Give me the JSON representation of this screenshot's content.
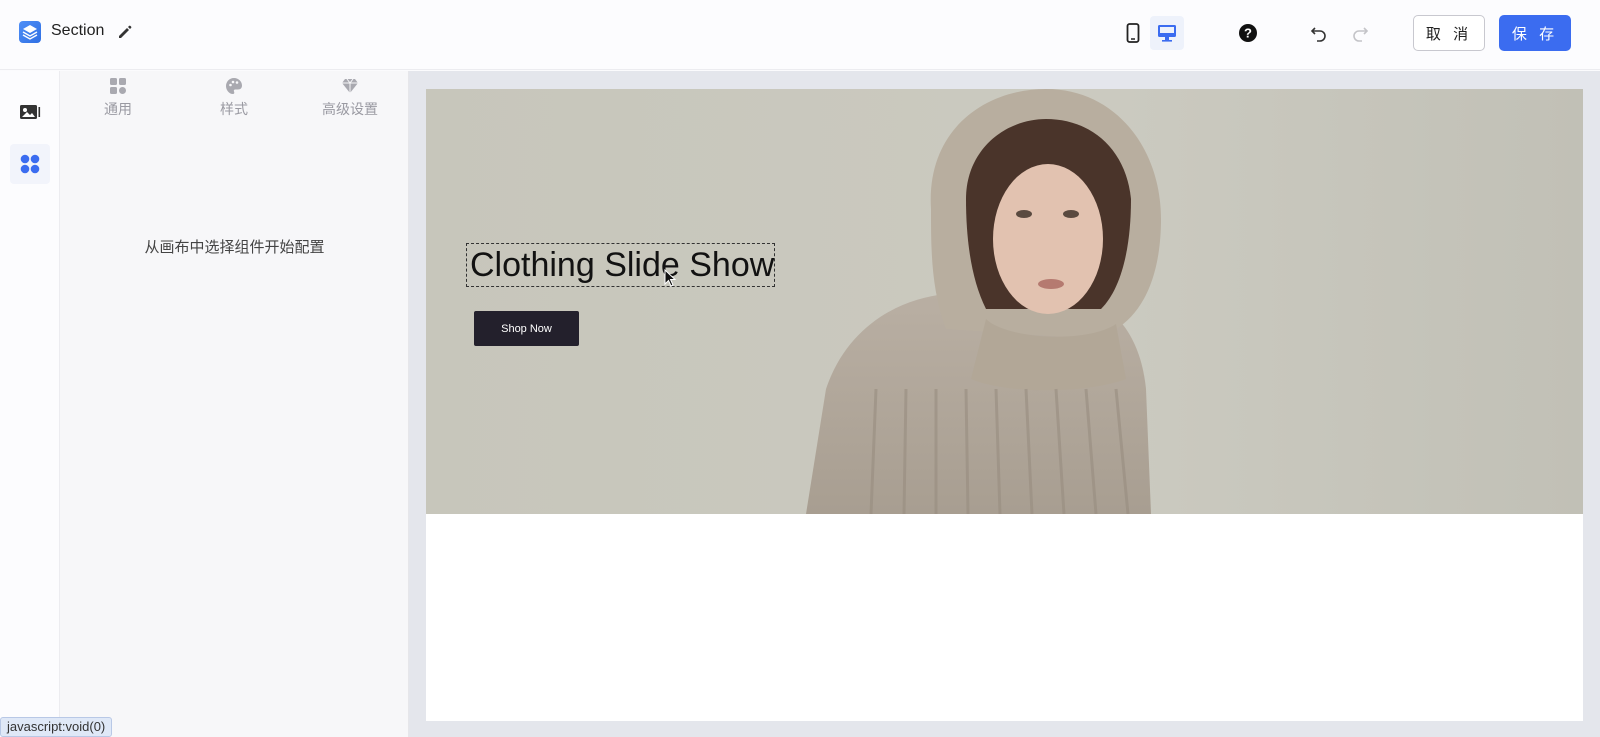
{
  "header": {
    "title": "Section",
    "cancel_label": "取 消",
    "save_label": "保 存",
    "icons": [
      "layers-icon",
      "pencil-icon",
      "mobile-icon",
      "desktop-icon",
      "help-icon",
      "undo-icon",
      "redo-icon"
    ]
  },
  "panel": {
    "tabs": [
      {
        "label": "通用",
        "icon": "grid-icon"
      },
      {
        "label": "样式",
        "icon": "palette-icon"
      },
      {
        "label": "高级设置",
        "icon": "diamond-icon"
      }
    ],
    "empty_message": "从画布中选择组件开始配置"
  },
  "hero": {
    "title": "Clothing Slide Show",
    "button_label": "Shop Now"
  },
  "status_bar": {
    "text": "javascript:void(0)"
  },
  "colors": {
    "accent": "#3b6cf0",
    "button_dark": "#23202c",
    "canvas_bg": "#e4e6ec"
  }
}
